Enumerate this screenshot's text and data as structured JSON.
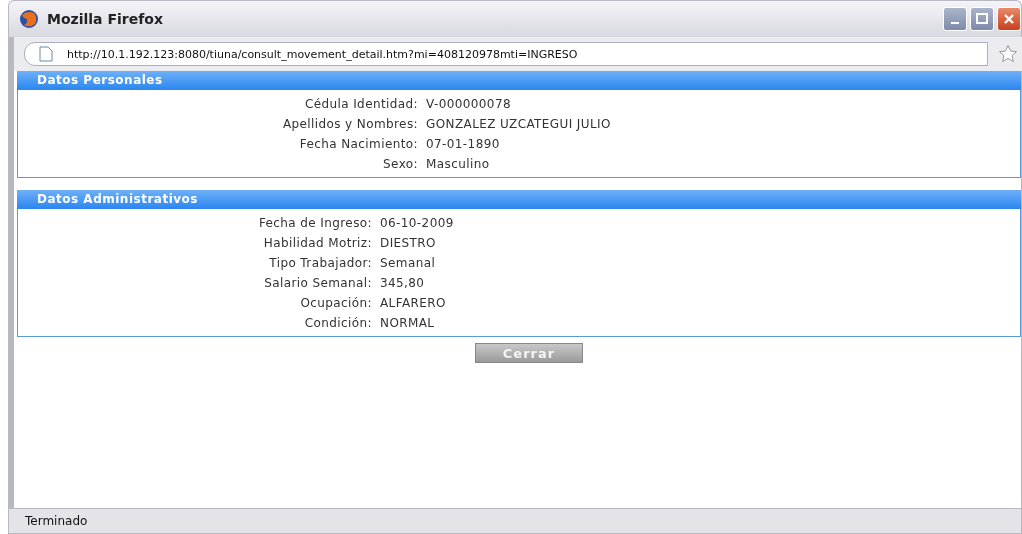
{
  "window": {
    "title": "Mozilla Firefox"
  },
  "address_bar": {
    "url": "http://10.1.192.123:8080/tiuna/consult_movement_detail.htm?mi=408120978mti=INGRESO"
  },
  "sections": [
    {
      "title": "Datos Personales",
      "fields": [
        {
          "label": "Cédula Identidad:",
          "value": "V-000000078"
        },
        {
          "label": "Apellidos y Nombres:",
          "value": "GONZALEZ UZCATEGUI JULIO"
        },
        {
          "label": "Fecha Nacimiento:",
          "value": "07-01-1890"
        },
        {
          "label": "Sexo:",
          "value": "Masculino"
        }
      ]
    },
    {
      "title": "Datos Administrativos",
      "fields": [
        {
          "label": "Fecha de Ingreso:",
          "value": "06-10-2009"
        },
        {
          "label": "Habilidad Motriz:",
          "value": "DIESTRO"
        },
        {
          "label": "Tipo Trabajador:",
          "value": "Semanal"
        },
        {
          "label": "Salario Semanal:",
          "value": "345,80"
        },
        {
          "label": "Ocupación:",
          "value": "ALFARERO"
        },
        {
          "label": "Condición:",
          "value": "NORMAL"
        }
      ]
    }
  ],
  "close_button": "Cerrar",
  "status_bar": "Terminado"
}
